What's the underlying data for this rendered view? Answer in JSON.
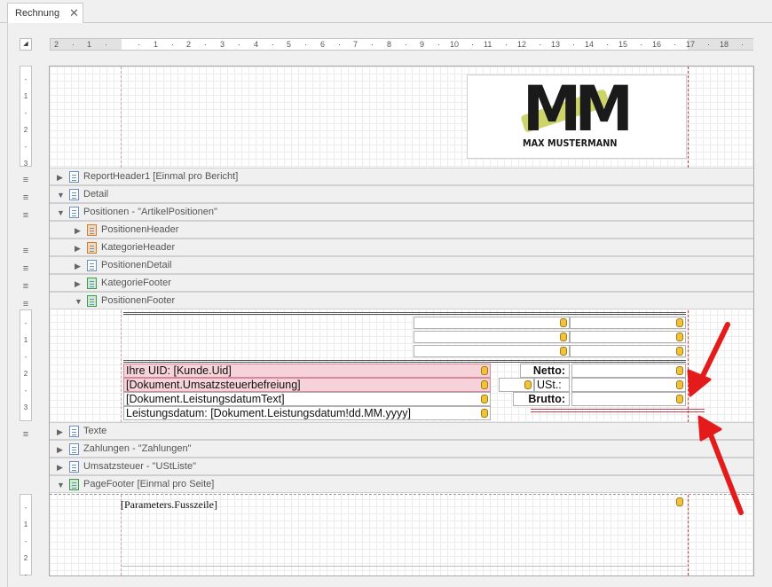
{
  "tab": {
    "label": "Rechnung",
    "close": "✕"
  },
  "ruler": {
    "corner": "◢",
    "h_ticks": [
      {
        "t": "2",
        "p": 4
      },
      {
        "t": "·",
        "p": 24
      },
      {
        "t": "1",
        "p": 41
      },
      {
        "t": "·",
        "p": 61
      },
      {
        "t": "·",
        "p": 98
      },
      {
        "t": "1",
        "p": 116
      },
      {
        "t": "·",
        "p": 136
      },
      {
        "t": "2",
        "p": 153
      },
      {
        "t": "·",
        "p": 173
      },
      {
        "t": "3",
        "p": 191
      },
      {
        "t": "·",
        "p": 211
      },
      {
        "t": "4",
        "p": 229
      },
      {
        "t": "·",
        "p": 249
      },
      {
        "t": "5",
        "p": 266
      },
      {
        "t": "·",
        "p": 286
      },
      {
        "t": "6",
        "p": 304
      },
      {
        "t": "·",
        "p": 324
      },
      {
        "t": "7",
        "p": 341
      },
      {
        "t": "·",
        "p": 361
      },
      {
        "t": "8",
        "p": 379
      },
      {
        "t": "·",
        "p": 399
      },
      {
        "t": "9",
        "p": 416
      },
      {
        "t": "·",
        "p": 436
      },
      {
        "t": "10",
        "p": 450
      },
      {
        "t": "·",
        "p": 474
      },
      {
        "t": "11",
        "p": 488
      },
      {
        "t": "·",
        "p": 512
      },
      {
        "t": "12",
        "p": 526
      },
      {
        "t": "·",
        "p": 550
      },
      {
        "t": "13",
        "p": 564
      },
      {
        "t": "·",
        "p": 588
      },
      {
        "t": "14",
        "p": 602
      },
      {
        "t": "·",
        "p": 626
      },
      {
        "t": "15",
        "p": 640
      },
      {
        "t": "·",
        "p": 664
      },
      {
        "t": "16",
        "p": 678
      },
      {
        "t": "·",
        "p": 702
      },
      {
        "t": "17",
        "p": 716
      },
      {
        "t": "·",
        "p": 740
      },
      {
        "t": "18",
        "p": 754
      },
      {
        "t": "·",
        "p": 778
      }
    ],
    "v1_ticks": [
      "-",
      "1",
      "-",
      "2",
      "-",
      "3"
    ],
    "v2_ticks": [
      "-",
      "1",
      "-",
      "2",
      "-",
      "3"
    ],
    "v3_ticks": [
      "-",
      "1",
      "-",
      "2",
      "-"
    ]
  },
  "logo": {
    "initials": "MM",
    "name": "MAX MUSTERMANN"
  },
  "bands": [
    {
      "label": "ReportHeader1 [Einmal pro Bericht]",
      "arrow": "▶",
      "icon": "blue",
      "indent": 0
    },
    {
      "label": "Detail",
      "arrow": "▼",
      "icon": "blue",
      "indent": 0
    },
    {
      "label": "Positionen - \"ArtikelPositionen\"",
      "arrow": "▼",
      "icon": "blue",
      "indent": 0
    },
    {
      "label": "PositionenHeader",
      "arrow": "▶",
      "icon": "orange",
      "indent": 1
    },
    {
      "label": "KategorieHeader",
      "arrow": "▶",
      "icon": "orange",
      "indent": 1
    },
    {
      "label": "PositionenDetail",
      "arrow": "▶",
      "icon": "blue",
      "indent": 1
    },
    {
      "label": "KategorieFooter",
      "arrow": "▶",
      "icon": "green",
      "indent": 1
    },
    {
      "label": "PositionenFooter",
      "arrow": "▼",
      "icon": "green",
      "indent": 1
    }
  ],
  "bands_after": [
    {
      "label": "Texte",
      "arrow": "▶",
      "icon": "blue"
    },
    {
      "label": "Zahlungen - \"Zahlungen\"",
      "arrow": "▶",
      "icon": "blue"
    },
    {
      "label": "Umsatzsteuer - \"UStListe\"",
      "arrow": "▶",
      "icon": "blue"
    },
    {
      "label": "PageFooter [Einmal pro Seite]",
      "arrow": "▼",
      "icon": "green"
    }
  ],
  "handles": "≡",
  "fields": {
    "uid": "Ihre UID: [Kunde.Uid]",
    "ust_befreiung": "[Dokument.Umsatzsteuerbefreiung]",
    "leistungsdatum_text": "[Dokument.LeistungsdatumText]",
    "leistungsdatum": "Leistungsdatum: [Dokument.Leistungsdatum!dd.MM.yyyy]",
    "netto": "Netto:",
    "ust": "USt.:",
    "brutto": "Brutto:",
    "fusszeile": "[Parameters.Fusszeile]"
  },
  "colors": {
    "annotation_arrow": "#e31b1b",
    "highlight": "#f6d3da"
  }
}
